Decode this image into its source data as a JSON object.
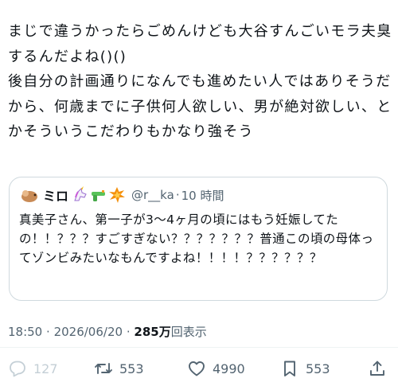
{
  "tweet": {
    "text": "まじで違うかったらごめんけども大谷すんごいモラ夫臭するんだよね()()\n後自分の計画通りになんでも進めたい人ではありそうだから、何歳までに子供何人欲しい、男が絶対欲しい、とかそういうこだわりもかなり強そう"
  },
  "quote": {
    "name": "ミロ",
    "handle": "@r__ka",
    "dot": "·",
    "time": "10 時間",
    "text": "真美子さん、第一子が3〜4ヶ月の頃にはもう妊娠してたの！！？？？すごすぎない？？？？？？？普通この頃の母体ってゾンビみたいなもんですよね！！！！？？？？？？",
    "avatar_icon": "dog-avatar",
    "emojis": [
      "unicorn-emoji",
      "water-pistol-emoji",
      "collision-emoji"
    ]
  },
  "meta": {
    "time": "18:50",
    "sep": "·",
    "date": "2026/06/20",
    "views": "285万",
    "views_label": "回表示"
  },
  "actions": {
    "reply_count": "127",
    "retweet_count": "553",
    "like_count": "4990",
    "bookmark_count": "553"
  }
}
